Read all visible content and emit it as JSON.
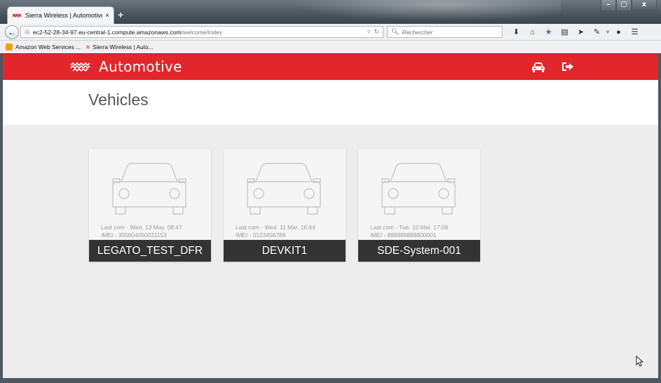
{
  "browser": {
    "tab_title": "Sierra Wireless | Automotive",
    "tab_close": "×",
    "new_tab": "+",
    "url_host": "ec2-52-28-34-97.eu-central-1.compute.amazonaws.com",
    "url_path": "/welcome/index",
    "search_placeholder": "Rechercher",
    "window_controls": [
      "–",
      "▢",
      "x"
    ]
  },
  "bookmarks": [
    {
      "label": "Amazon Web Services ..."
    },
    {
      "label": "Sierra Wireless | Auto..."
    }
  ],
  "app": {
    "brand": "Automotive",
    "header_color": "#e3262b"
  },
  "page": {
    "title": "Vehicles"
  },
  "vehicles": [
    {
      "last_com": "Last com - Wed. 13 May. 08:47",
      "imei": "IMEI - 355604050021153",
      "name": "LEGATO_TEST_DFR"
    },
    {
      "last_com": "Last com - Wed. 11 Mar. 16:44",
      "imei": "IMEI - 0123456789",
      "name": "DEVKIT1"
    },
    {
      "last_com": "Last com - Tue. 10 Mar. 17:08",
      "imei": "IMEI - 888888888800001",
      "name": "SDE-System-001"
    }
  ]
}
